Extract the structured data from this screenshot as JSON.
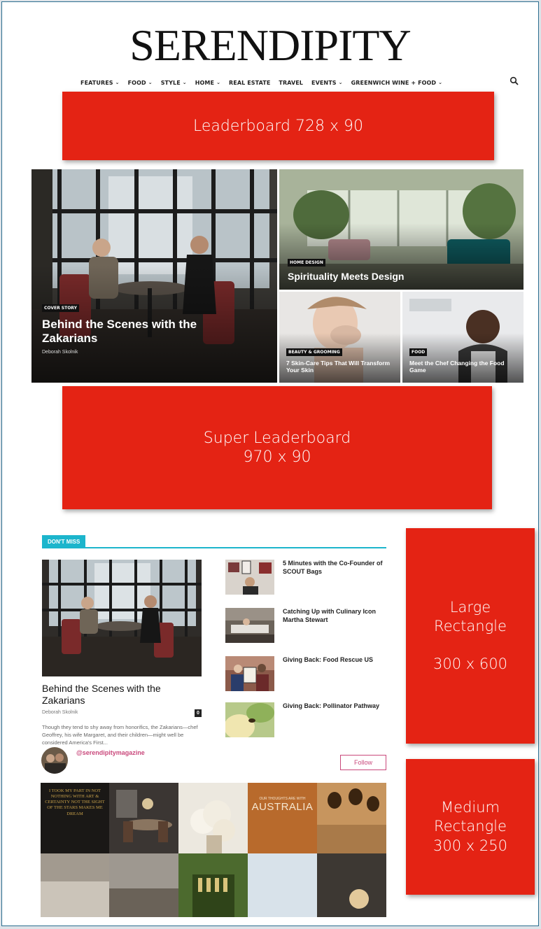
{
  "masthead": {
    "logo": "SERENDIPITY"
  },
  "nav": {
    "items": [
      {
        "label": "FEATURES",
        "dropdown": true
      },
      {
        "label": "FOOD",
        "dropdown": true
      },
      {
        "label": "STYLE",
        "dropdown": true
      },
      {
        "label": "HOME",
        "dropdown": true
      },
      {
        "label": "REAL ESTATE",
        "dropdown": false
      },
      {
        "label": "TRAVEL",
        "dropdown": false
      },
      {
        "label": "EVENTS",
        "dropdown": true
      },
      {
        "label": "GREENWICH WINE + FOOD",
        "dropdown": true
      }
    ],
    "search_icon": "search-icon"
  },
  "ads": {
    "leaderboard": "Leaderboard 728 x 90",
    "super_leaderboard": {
      "line1": "Super Leaderboard",
      "line2": "970 x 90"
    },
    "large_rectangle": {
      "line1": "Large",
      "line2": "Rectangle",
      "line3": "300 x 600"
    },
    "medium_rectangle": {
      "line1": "Medium",
      "line2": "Rectangle",
      "line3": "300 x 250"
    }
  },
  "hero": {
    "main": {
      "tag": "COVER STORY",
      "title": "Behind the Scenes with the Zakarians",
      "author": "Deborah Skolnik"
    },
    "top_right": {
      "tag": "HOME DESIGN",
      "title": "Spirituality Meets Design"
    },
    "bottom_left": {
      "tag": "BEAUTY & GROOMING",
      "title": "7 Skin-Care Tips That Will Transform Your Skin"
    },
    "bottom_right": {
      "tag": "FOOD",
      "title": "Meet the Chef Changing the Food Game"
    }
  },
  "dont_miss": {
    "label": "DON'T MISS",
    "feature": {
      "title": "Behind the Scenes with the Zakarians",
      "author": "Deborah Skolnik",
      "comments": "0",
      "excerpt": "Though they tend to shy away from honorifics, the Zakarians—chef Geoffrey, his wife Margaret, and their children—might well be considered America's First..."
    },
    "items": [
      {
        "title": "5 Minutes with the Co-Founder of SCOUT Bags"
      },
      {
        "title": "Catching Up with Culinary Icon Martha Stewart"
      },
      {
        "title": "Giving Back: Food Rescue US"
      },
      {
        "title": "Giving Back: Pollinator Pathway"
      }
    ]
  },
  "instagram": {
    "handle": "@serendipitymagazine",
    "follow_label": "Follow",
    "tile_texts": {
      "quote": "I TOOK MY PART IN NOT NOTHING WITH ART & CERTAINTY NOT THE SIGHT OF THE STARS MAKES ME DREAM",
      "australia_small": "OUR THOUGHTS ARE WITH",
      "australia": "AUSTRALIA"
    }
  },
  "colors": {
    "ad_red": "#e42314",
    "accent_cyan": "#1cb5cc",
    "follow_pink": "#c9487b",
    "frame_border": "#2c6e8f"
  }
}
